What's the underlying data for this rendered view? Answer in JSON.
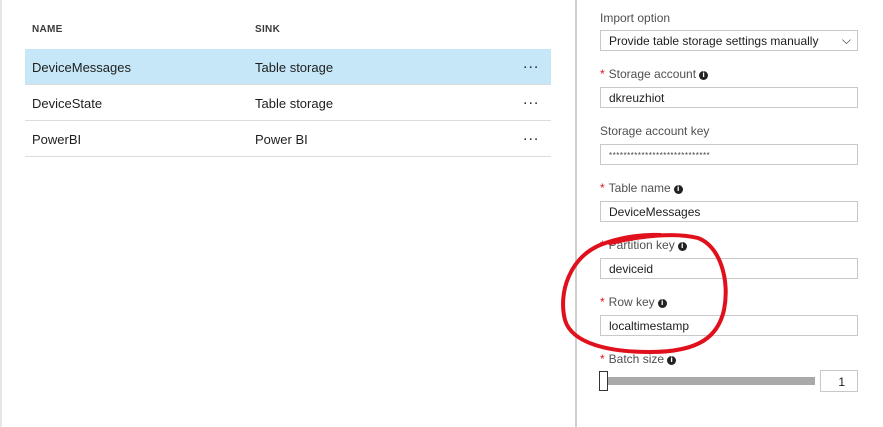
{
  "outputs": {
    "columns": {
      "name": "NAME",
      "sink": "SINK"
    },
    "rows": [
      {
        "name": "DeviceMessages",
        "sink": "Table storage",
        "more": "..."
      },
      {
        "name": "DeviceState",
        "sink": "Table storage",
        "more": "..."
      },
      {
        "name": "PowerBI",
        "sink": "Power BI",
        "more": "..."
      }
    ]
  },
  "form": {
    "import_option": {
      "label": "Import option",
      "value": "Provide table storage settings manually"
    },
    "storage_account": {
      "label": "Storage account",
      "value": "dkreuzhiot"
    },
    "storage_account_key": {
      "label": "Storage account key",
      "value": "****************************"
    },
    "table_name": {
      "label": "Table name",
      "value": "DeviceMessages"
    },
    "partition_key": {
      "label": "Partition key",
      "value": "deviceid"
    },
    "row_key": {
      "label": "Row key",
      "value": "localtimestamp"
    },
    "batch_size": {
      "label": "Batch size",
      "value": "1"
    },
    "required_mark": "*",
    "info_glyph": "i"
  },
  "annotation": {
    "color": "#e0101c"
  }
}
